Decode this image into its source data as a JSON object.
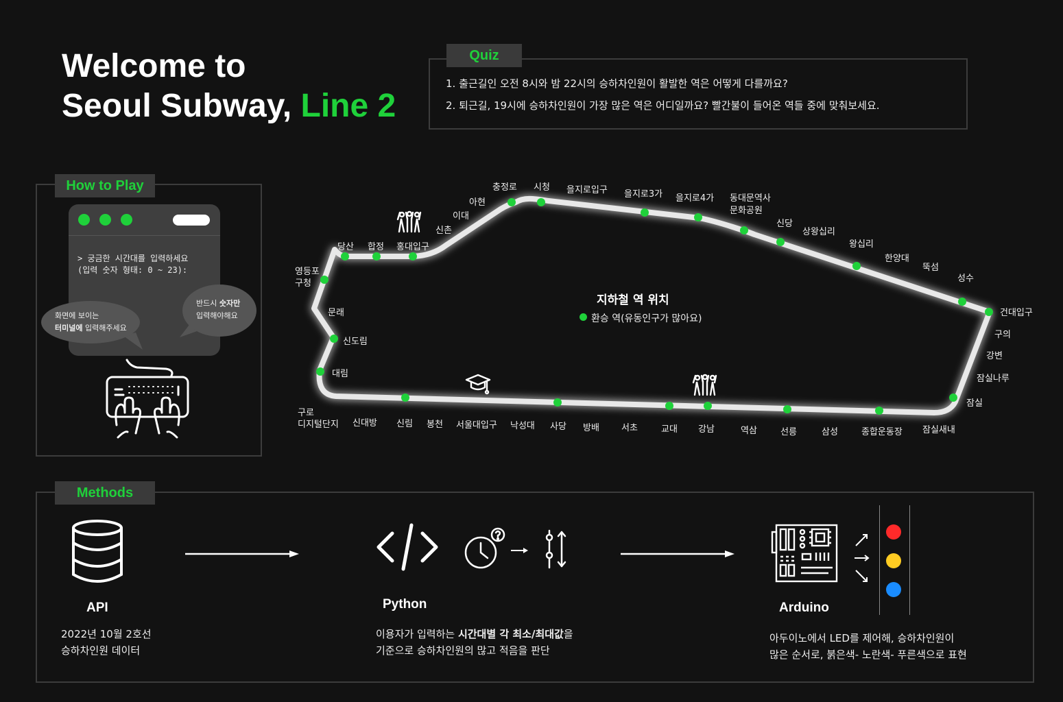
{
  "header": {
    "title_line1": "Welcome to",
    "title_line2_prefix": "Seoul Subway, ",
    "title_line2_accent": "Line 2"
  },
  "quiz": {
    "tab": "Quiz",
    "questions": [
      "1. 출근길인 오전 8시와 밤 22시의 승하차인원이 활발한 역은 어떻게 다를까요?",
      "2. 퇴근길, 19시에 승하차인원이 가장 많은 역은 어디일까요? 빨간불이 들어온 역들 중에 맞춰보세요."
    ]
  },
  "how_to_play": {
    "tab": "How to Play",
    "terminal_line1": "> 궁금한 시간대를 입력하세요",
    "terminal_line2": "(입력 숫자 형태: 0 ~ 23):",
    "bubble_left_line1": "화면에 보이는",
    "bubble_left_bold": "터미널에",
    "bubble_left_rest": " 입력해주세요",
    "bubble_right_prefix": "반드시 ",
    "bubble_right_bold": "숫자만",
    "bubble_right_line2": "입력해야해요"
  },
  "map": {
    "title": "지하철 역 위치",
    "legend": "환승 역(유동인구가 많아요)",
    "accent_color": "#1fd13a",
    "stations": [
      "충정로",
      "시청",
      "을지로입구",
      "을지로3가",
      "을지로4가",
      "동대문역사",
      "문화공원",
      "아현",
      "이대",
      "신촌",
      "홍대입구",
      "합정",
      "당산",
      "영등포",
      "구청",
      "문래",
      "신도림",
      "대림",
      "구로",
      "디지털단지",
      "신대방",
      "신림",
      "봉천",
      "서울대입구",
      "낙성대",
      "사당",
      "방배",
      "서초",
      "교대",
      "강남",
      "역삼",
      "선릉",
      "삼성",
      "종합운동장",
      "잠실새내",
      "잠실",
      "잠실나루",
      "강변",
      "구의",
      "건대입구",
      "성수",
      "뚝섬",
      "한양대",
      "왕십리",
      "상왕십리",
      "신당"
    ]
  },
  "methods": {
    "tab": "Methods",
    "api_title": "API",
    "api_desc1": "2022년 10월 2호선",
    "api_desc2": "승하차인원 데이터",
    "python_title": "Python",
    "python_desc1_pre": "이용자가 입력하는 ",
    "python_desc1_bold": "시간대별 각 최소/최대값",
    "python_desc1_post": "을",
    "python_desc2": "기준으로 승하차인원의 많고 적음을 판단",
    "arduino_title": "Arduino",
    "arduino_desc1": "아두이노에서 LED를 제어해, 승하차인원이",
    "arduino_desc2": "많은 순서로, 붉은색- 노란색- 푸른색으로 표현",
    "led_colors": [
      "#ff2a2a",
      "#ffcc22",
      "#1a8cff"
    ]
  }
}
